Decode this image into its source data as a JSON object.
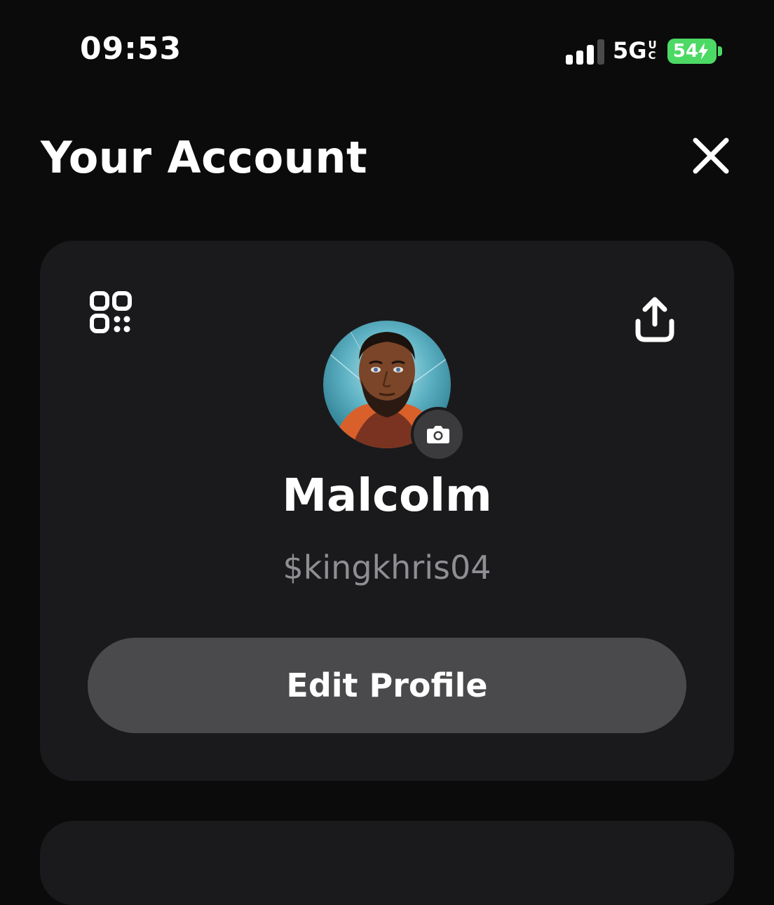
{
  "status_bar": {
    "time": "09:53",
    "network_label": "5G",
    "network_sub_top": "U",
    "network_sub_bottom": "C",
    "battery_level": "54",
    "battery_color": "#4cd964",
    "signal_bars_active": 3,
    "signal_bars_total": 4
  },
  "header": {
    "title": "Your Account",
    "close_icon": "close-icon"
  },
  "profile_card": {
    "qr_icon": "qr-code-icon",
    "share_icon": "share-icon",
    "camera_icon": "camera-icon",
    "display_name": "Malcolm",
    "cashtag": "$kingkhris04",
    "edit_button_label": "Edit Profile"
  },
  "colors": {
    "background": "#0b0b0c",
    "card": "#1a1a1c",
    "button": "#4a4a4c",
    "muted_text": "#8e8e93"
  }
}
